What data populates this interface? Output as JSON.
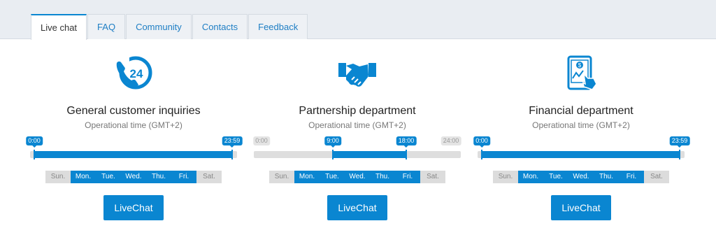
{
  "tabs": [
    {
      "label": "Live chat",
      "active": true
    },
    {
      "label": "FAQ",
      "active": false
    },
    {
      "label": "Community",
      "active": false
    },
    {
      "label": "Contacts",
      "active": false
    },
    {
      "label": "Feedback",
      "active": false
    }
  ],
  "colors": {
    "accent": "#0a86d1",
    "inactive_day": "#dcdcdc",
    "track": "#dedede"
  },
  "departments": [
    {
      "icon": "phone-24-icon",
      "title": "General customer inquiries",
      "subtitle": "Operational time (GMT+2)",
      "open": "0:00",
      "close": "23:59",
      "days": [
        {
          "label": "Sun.",
          "on": false
        },
        {
          "label": "Mon.",
          "on": true
        },
        {
          "label": "Tue.",
          "on": true
        },
        {
          "label": "Wed.",
          "on": true
        },
        {
          "label": "Thu.",
          "on": true
        },
        {
          "label": "Fri.",
          "on": true
        },
        {
          "label": "Sat.",
          "on": false
        }
      ],
      "button": "LiveChat"
    },
    {
      "icon": "handshake-icon",
      "title": "Partnership department",
      "subtitle": "Operational time (GMT+2)",
      "range_start": "0:00",
      "range_end": "24:00",
      "open": "9:00",
      "close": "18:00",
      "days": [
        {
          "label": "Sun.",
          "on": false
        },
        {
          "label": "Mon.",
          "on": true
        },
        {
          "label": "Tue.",
          "on": true
        },
        {
          "label": "Wed.",
          "on": true
        },
        {
          "label": "Thu.",
          "on": true
        },
        {
          "label": "Fri.",
          "on": true
        },
        {
          "label": "Sat.",
          "on": false
        }
      ],
      "button": "LiveChat"
    },
    {
      "icon": "tablet-finance-icon",
      "title": "Financial department",
      "subtitle": "Operational time (GMT+2)",
      "open": "0:00",
      "close": "23:59",
      "days": [
        {
          "label": "Sun.",
          "on": false
        },
        {
          "label": "Mon.",
          "on": true
        },
        {
          "label": "Tue.",
          "on": true
        },
        {
          "label": "Wed.",
          "on": true
        },
        {
          "label": "Thu.",
          "on": true
        },
        {
          "label": "Fri.",
          "on": true
        },
        {
          "label": "Sat.",
          "on": false
        }
      ],
      "button": "LiveChat"
    }
  ]
}
